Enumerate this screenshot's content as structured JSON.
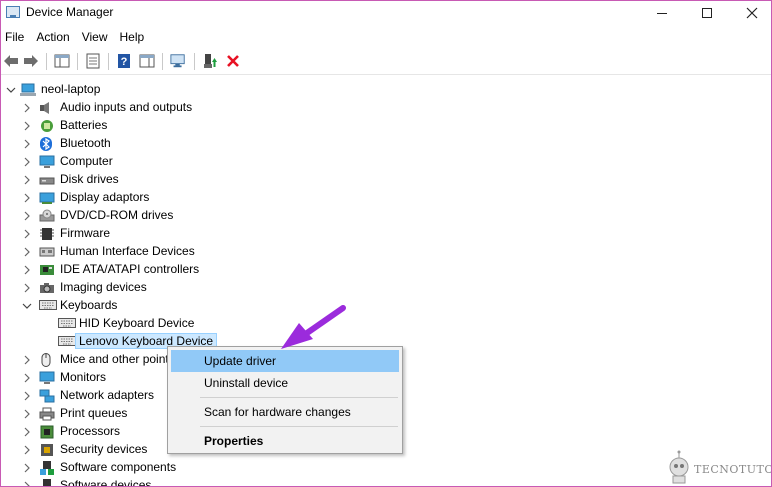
{
  "window": {
    "title": "Device Manager",
    "border_color": "#c85ab4"
  },
  "menu": [
    "File",
    "Action",
    "View",
    "Help"
  ],
  "toolbar": {
    "buttons": [
      {
        "name": "back-icon"
      },
      {
        "name": "forward-icon"
      },
      {
        "name": "show-hide-console-tree-icon"
      },
      {
        "name": "properties-icon"
      },
      {
        "name": "help-icon"
      },
      {
        "name": "action-pane-icon"
      },
      {
        "name": "scan-hardware-icon"
      },
      {
        "name": "update-driver-icon"
      },
      {
        "name": "uninstall-device-icon"
      }
    ]
  },
  "tree": {
    "root": "neol-laptop",
    "categories": [
      {
        "label": "Audio inputs and outputs",
        "icon": "speaker-icon",
        "expanded": false
      },
      {
        "label": "Batteries",
        "icon": "battery-icon",
        "expanded": false
      },
      {
        "label": "Bluetooth",
        "icon": "bluetooth-icon",
        "expanded": false
      },
      {
        "label": "Computer",
        "icon": "computer-icon",
        "expanded": false
      },
      {
        "label": "Disk drives",
        "icon": "disk-drive-icon",
        "expanded": false
      },
      {
        "label": "Display adaptors",
        "icon": "display-adapter-icon",
        "expanded": false
      },
      {
        "label": "DVD/CD-ROM drives",
        "icon": "dvd-icon",
        "expanded": false
      },
      {
        "label": "Firmware",
        "icon": "firmware-icon",
        "expanded": false
      },
      {
        "label": "Human Interface Devices",
        "icon": "hid-icon",
        "expanded": false
      },
      {
        "label": "IDE ATA/ATAPI controllers",
        "icon": "ide-controller-icon",
        "expanded": false
      },
      {
        "label": "Imaging devices",
        "icon": "camera-icon",
        "expanded": false
      },
      {
        "label": "Keyboards",
        "icon": "keyboard-icon",
        "expanded": true
      },
      {
        "label": "Mice and other point",
        "icon": "mouse-icon",
        "expanded": false
      },
      {
        "label": "Monitors",
        "icon": "monitor-icon",
        "expanded": false
      },
      {
        "label": "Network adapters",
        "icon": "network-adapter-icon",
        "expanded": false
      },
      {
        "label": "Print queues",
        "icon": "printer-icon",
        "expanded": false
      },
      {
        "label": "Processors",
        "icon": "processor-icon",
        "expanded": false
      },
      {
        "label": "Security devices",
        "icon": "security-device-icon",
        "expanded": false
      },
      {
        "label": "Software components",
        "icon": "software-component-icon",
        "expanded": false
      },
      {
        "label": "Software devices",
        "icon": "software-device-icon",
        "expanded": false
      }
    ],
    "keyboard_children": [
      {
        "label": "HID Keyboard Device",
        "selected": false
      },
      {
        "label": "Lenovo Keyboard Device",
        "selected": true
      }
    ]
  },
  "context_menu": {
    "items": [
      {
        "label": "Update driver",
        "highlighted": true,
        "bold": false
      },
      {
        "label": "Uninstall device",
        "highlighted": false,
        "bold": false
      },
      {
        "label": "Scan for hardware changes",
        "highlighted": false,
        "bold": false
      },
      {
        "label": "Properties",
        "highlighted": false,
        "bold": true
      }
    ]
  },
  "annotation": {
    "icon": "arrow-pointer-icon",
    "color": "#9b2bdc"
  },
  "watermark": {
    "text": "TECNOTUTO",
    "icon": "robot-logo-icon"
  },
  "colors": {
    "selection_bg": "#cce8ff",
    "menu_highlight": "#91c9f7",
    "delete_red": "#e81123"
  }
}
